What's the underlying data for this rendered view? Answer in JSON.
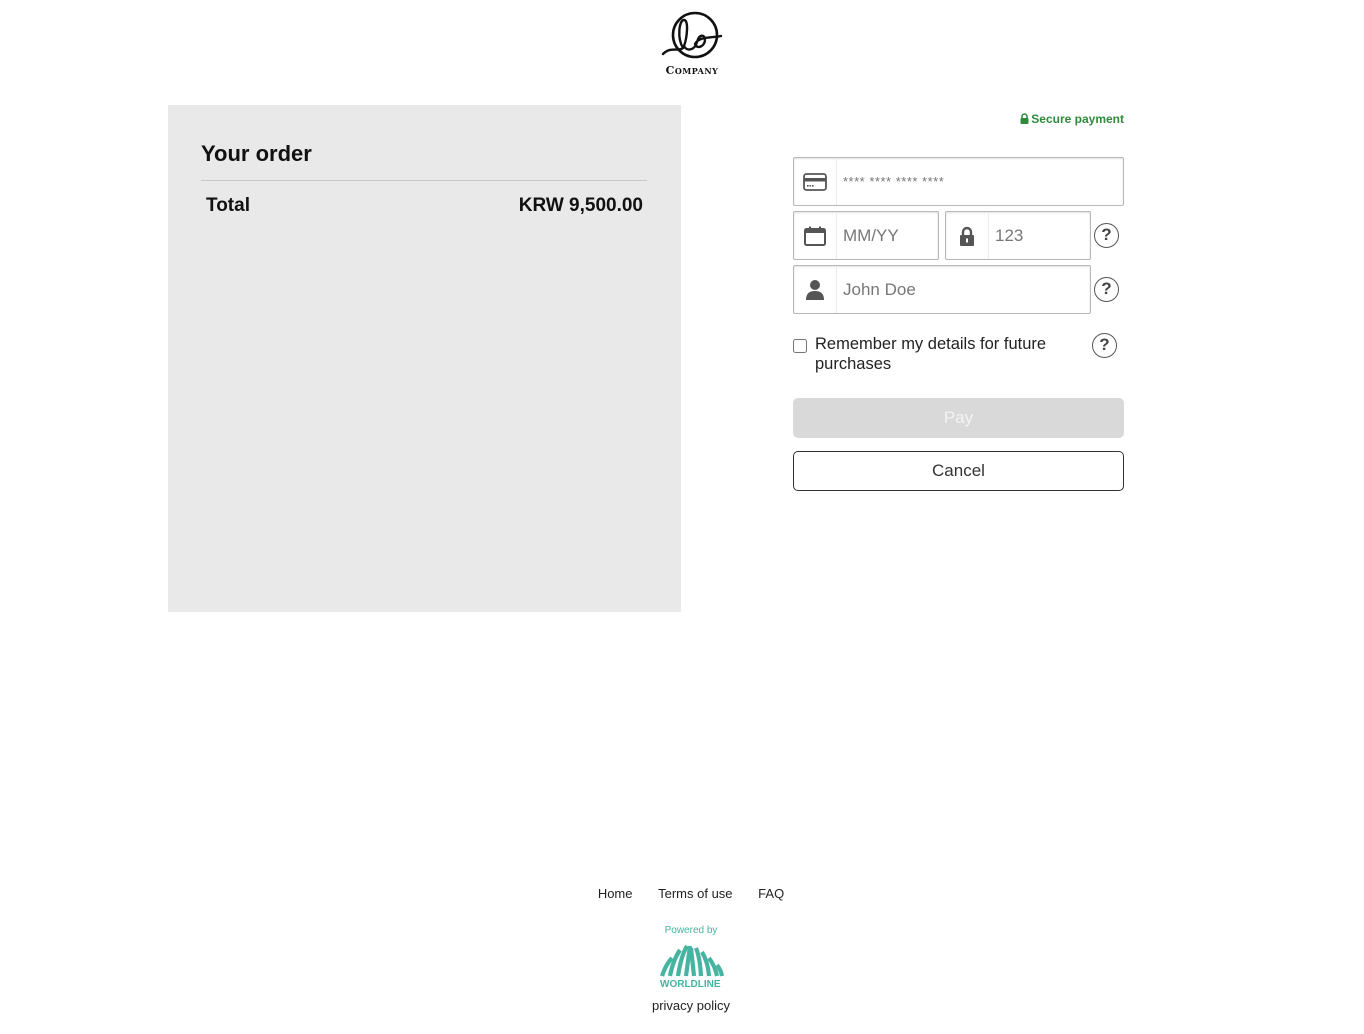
{
  "brand": {
    "logo_text": "Company"
  },
  "order": {
    "title": "Your order",
    "total_label": "Total",
    "total_value": "KRW 9,500.00"
  },
  "payment": {
    "secure_label": "Secure payment",
    "card_number": {
      "placeholder": "**** **** **** ****",
      "icon": "credit-card-icon"
    },
    "expiry": {
      "placeholder": "MM/YY",
      "icon": "calendar-icon"
    },
    "cvv": {
      "placeholder": "123",
      "icon": "lock-icon"
    },
    "cardholder": {
      "placeholder": "John Doe",
      "icon": "user-icon"
    },
    "help_symbol": "?",
    "remember_label": "Remember my details for future purchases",
    "remember_checked": false,
    "pay_label": "Pay",
    "cancel_label": "Cancel"
  },
  "footer": {
    "links": [
      "Home",
      "Terms of use",
      "FAQ"
    ],
    "powered_by": "Powered by",
    "provider": "WORLDLINE",
    "privacy_label": "privacy policy"
  },
  "colors": {
    "secure_green": "#2f8a3b",
    "worldline_teal": "#46b4a0",
    "order_panel_bg": "#e9e9e9",
    "pay_disabled_bg": "#d9d9d9"
  }
}
